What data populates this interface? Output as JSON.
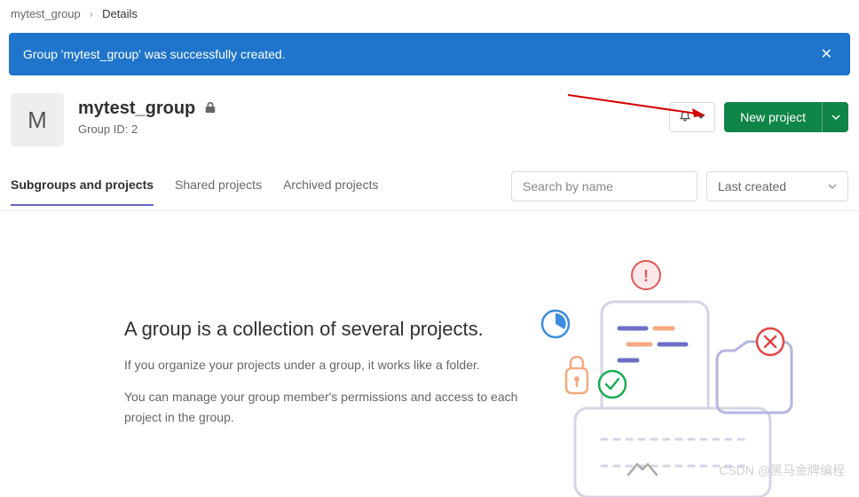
{
  "breadcrumb": {
    "parent": "mytest_group",
    "current": "Details"
  },
  "alert": {
    "message": "Group 'mytest_group' was successfully created."
  },
  "header": {
    "avatar_letter": "M",
    "title": "mytest_group",
    "group_id_label": "Group ID: 2"
  },
  "actions": {
    "new_project_label": "New project"
  },
  "tabs": {
    "subgroups": "Subgroups and projects",
    "shared": "Shared projects",
    "archived": "Archived projects"
  },
  "search": {
    "placeholder": "Search by name"
  },
  "sort": {
    "selected": "Last created"
  },
  "empty": {
    "title": "A group is a collection of several projects.",
    "desc1": "If you organize your projects under a group, it works like a folder.",
    "desc2": "You can manage your group member's permissions and access to each project in the group."
  },
  "watermark": "CSDN @黑马金牌编程"
}
